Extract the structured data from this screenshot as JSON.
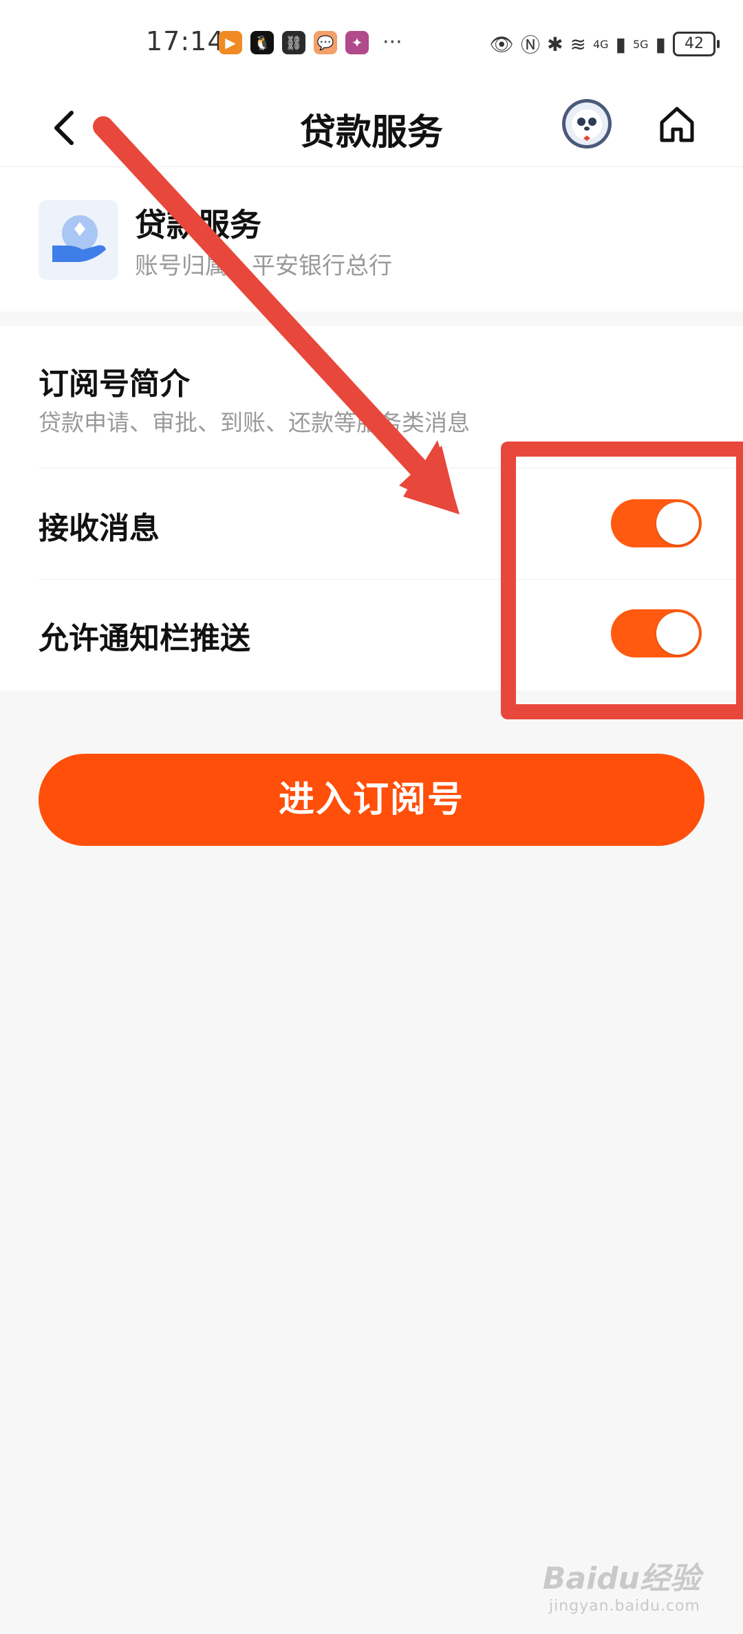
{
  "status_bar": {
    "time": "17:14",
    "battery": "42",
    "network_4g": "4G",
    "network_5g": "5G",
    "more": "···"
  },
  "nav": {
    "title": "贷款服务"
  },
  "account": {
    "name": "贷款服务",
    "owner": "账号归属：平安银行总行"
  },
  "intro": {
    "title": "订阅号简介",
    "description": "贷款申请、审批、到账、还款等服务类消息"
  },
  "settings": [
    {
      "label": "接收消息",
      "enabled": true
    },
    {
      "label": "允许通知栏推送",
      "enabled": true
    }
  ],
  "actions": {
    "enter_label": "进入订阅号"
  },
  "watermark": {
    "brand": "Baidu经验",
    "url": "jingyan.baidu.com"
  },
  "colors": {
    "accent": "#ff4f0a",
    "toggle_on": "#ff5a0f",
    "annotation": "#e8473b"
  }
}
